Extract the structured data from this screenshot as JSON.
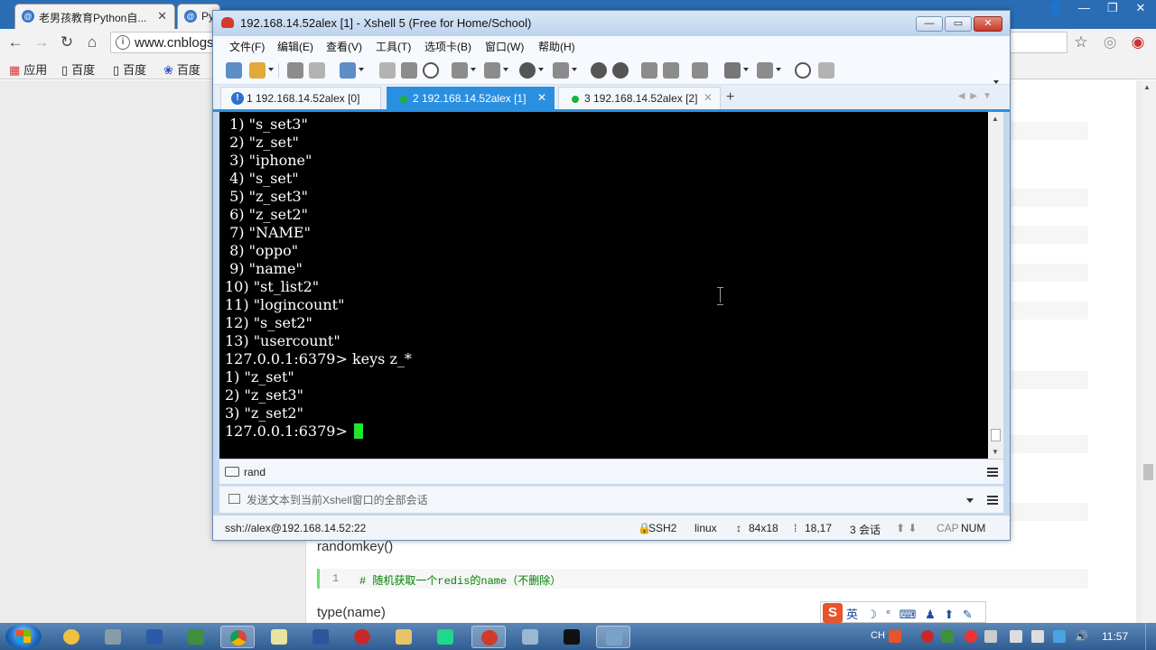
{
  "browser": {
    "tabs": [
      {
        "title": "老男孩教育Python自..."
      },
      {
        "title": "Py"
      }
    ],
    "url": "www.cnblogs",
    "bookmarks": [
      {
        "label": "应用"
      },
      {
        "label": "百度"
      },
      {
        "label": "百度"
      },
      {
        "label": "百度"
      }
    ],
    "article": {
      "heading1": "randomkey()",
      "code1_line": "1",
      "code1": "# 随机获取一个redis的name（不删除）",
      "heading2": "type(name)"
    }
  },
  "xshell": {
    "title": "192.168.14.52alex [1] - Xshell 5 (Free for Home/School)",
    "window_buttons": {
      "minimize": "—",
      "maximize": "▭",
      "close": "✕"
    },
    "menu": [
      "文件(F)",
      "编辑(E)",
      "查看(V)",
      "工具(T)",
      "选项卡(B)",
      "窗口(W)",
      "帮助(H)"
    ],
    "tabs": [
      {
        "label": "1 192.168.14.52alex [0]",
        "status": "warning"
      },
      {
        "label": "2 192.168.14.52alex [1]",
        "status": "connected",
        "active": true
      },
      {
        "label": "3 192.168.14.52alex [2]",
        "status": "connected"
      }
    ],
    "tab_add": "+",
    "terminal": {
      "lines": [
        " 1) \"s_set3\"",
        " 2) \"z_set\"",
        " 3) \"iphone\"",
        " 4) \"s_set\"",
        " 5) \"z_set3\"",
        " 6) \"z_set2\"",
        " 7) \"NAME\"",
        " 8) \"oppo\"",
        " 9) \"name\"",
        "10) \"st_list2\"",
        "11) \"logincount\"",
        "12) \"s_set2\"",
        "13) \"usercount\"",
        "127.0.0.1:6379> keys z_*",
        "1) \"z_set\"",
        "2) \"z_set3\"",
        "3) \"z_set2\""
      ],
      "prompt": "127.0.0.1:6379> "
    },
    "quickbar_label": "rand",
    "send_placeholder": "发送文本到当前Xshell窗口的全部会话",
    "status": {
      "connection": "ssh://alex@192.168.14.52:22",
      "protocol": "SSH2",
      "os": "linux",
      "size": "84x18",
      "cursor": "18,17",
      "sessions": "3 会话",
      "cap": "CAP",
      "num": "NUM"
    }
  },
  "taskbar": {
    "ime_lang": "CH",
    "ime_items": "英 ☽ ° ⌨ ♟ ⬆ ✎",
    "clock": "11:57"
  },
  "colors": {
    "accent": "#2b8fe0",
    "terminal_bg": "#000000",
    "terminal_fg": "#ffffff",
    "cursor": "#1ee62a",
    "connected_dot": "#18b33a"
  }
}
